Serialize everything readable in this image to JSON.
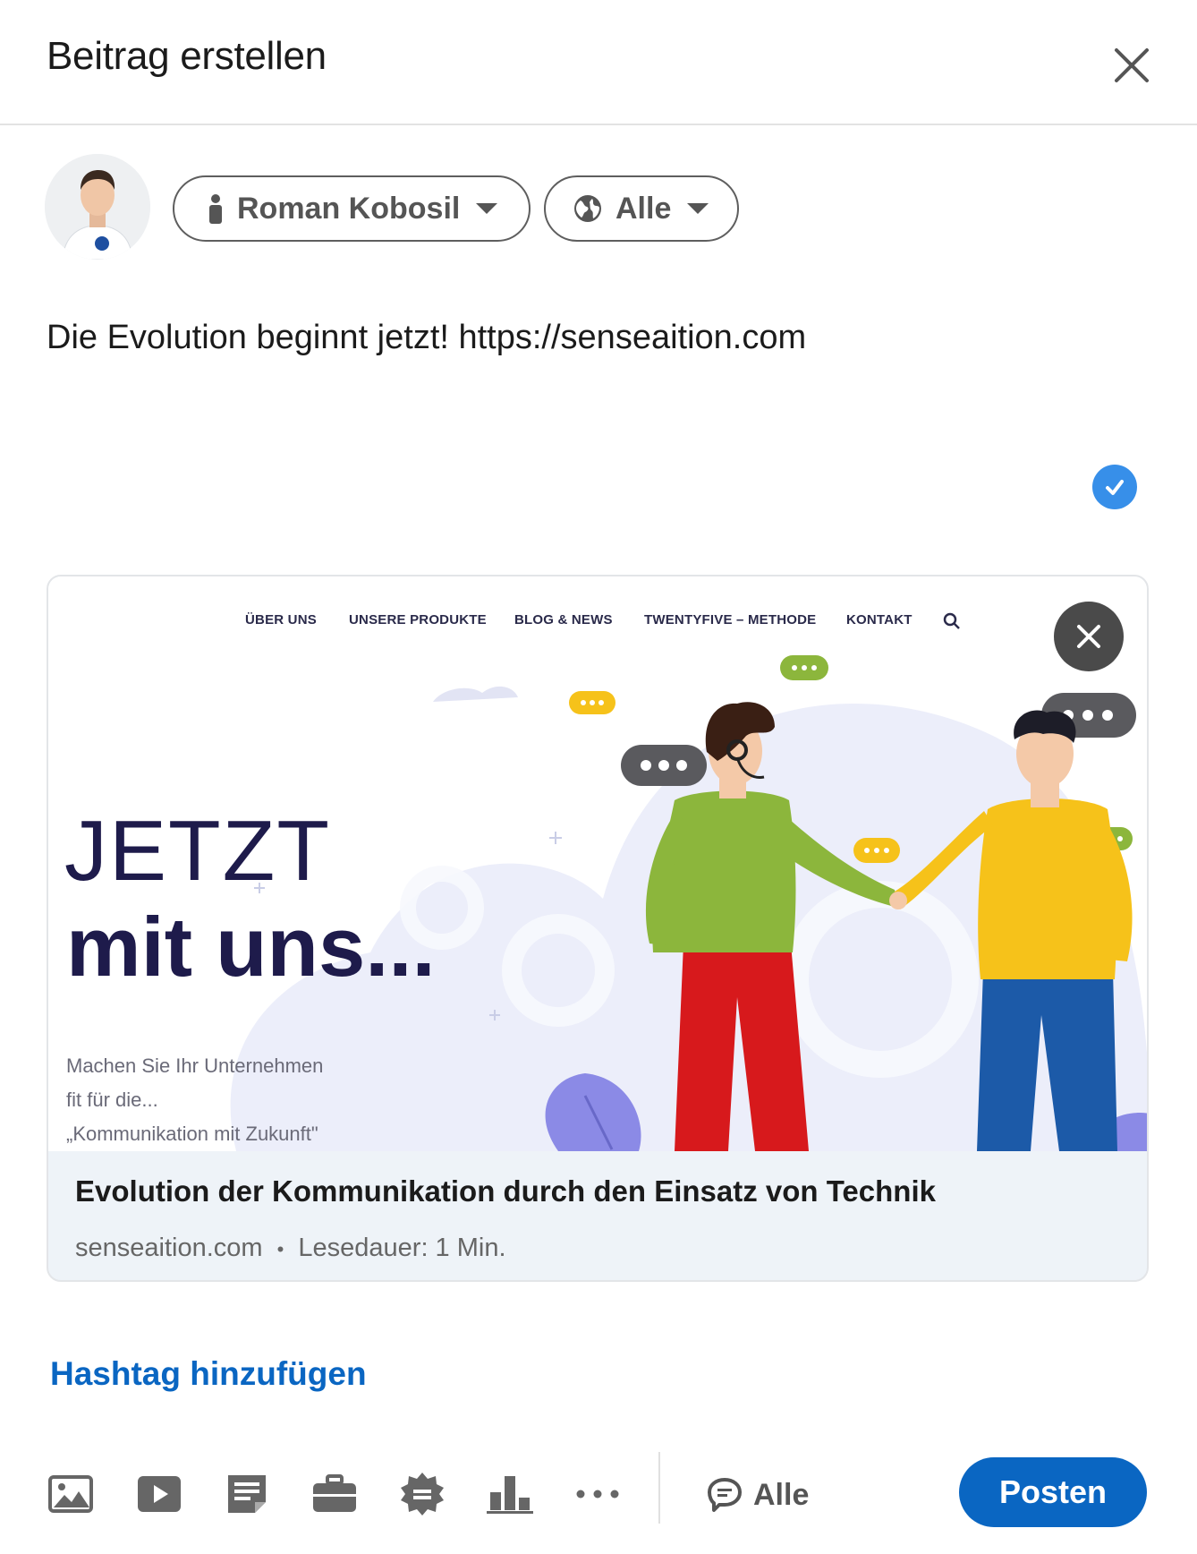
{
  "dialog": {
    "title": "Beitrag erstellen"
  },
  "author": {
    "name": "Roman Kobosil"
  },
  "visibility": {
    "label": "Alle"
  },
  "post": {
    "text": "Die Evolution beginnt jetzt! https://senseaition.com"
  },
  "preview": {
    "nav_items": [
      "ÜBER UNS",
      "UNSERE PRODUKTE",
      "BLOG & NEWS",
      "TWENTYFIVE – METHODE",
      "KONTAKT"
    ],
    "headline_1": "JETZT",
    "headline_2": "mit uns...",
    "tagline_1": "Machen Sie Ihr Unternehmen",
    "tagline_2": "fit für die...",
    "tagline_3": "„Kommunikation mit Zukunft\"",
    "title": "Evolution der Kommunikation durch den Einsatz von Technik",
    "domain": "senseaition.com",
    "separator": "•",
    "reading_time": "Lesedauer: 1 Min."
  },
  "hashtag": {
    "label": "Hashtag hinzufügen"
  },
  "toolbar": {
    "tools": [
      "image-icon",
      "video-icon",
      "document-icon",
      "job-icon",
      "celebrate-icon",
      "poll-icon",
      "more-icon"
    ],
    "comment_label": "Alle",
    "post_label": "Posten"
  },
  "colors": {
    "primary": "#0a66c2",
    "check": "#378fe9",
    "card_bg": "#eef3f8",
    "navy": "#1e1b4b",
    "green_shirt": "#8cb63c",
    "yellow_shirt": "#f6c21a",
    "red_pants": "#d7191c",
    "blue_pants": "#1c5aa8"
  }
}
